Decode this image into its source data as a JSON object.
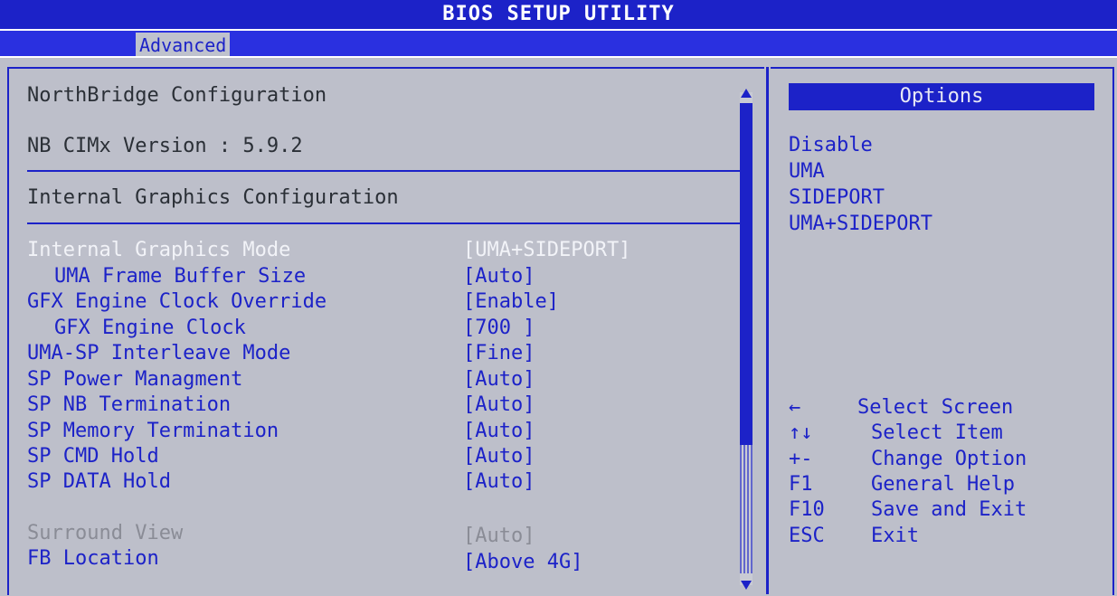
{
  "title": "BIOS SETUP UTILITY",
  "active_tab": "Advanced",
  "section_title": "NorthBridge Configuration",
  "version_line": "NB CIMx Version : 5.9.2",
  "subsection_title": "Internal Graphics Configuration",
  "settings": [
    {
      "label": "Internal Graphics Mode",
      "value": "[UMA+SIDEPORT]"
    },
    {
      "label": "UMA Frame Buffer Size",
      "value": "[Auto]"
    },
    {
      "label": "GFX Engine Clock Override",
      "value": "[Enable]"
    },
    {
      "label": "GFX Engine Clock",
      "value": "[700 ]"
    },
    {
      "label": "UMA-SP Interleave Mode",
      "value": "[Fine]"
    },
    {
      "label": "SP Power Managment",
      "value": "[Auto]"
    },
    {
      "label": "SP NB Termination",
      "value": "[Auto]"
    },
    {
      "label": "SP Memory Termination",
      "value": "[Auto]"
    },
    {
      "label": "SP CMD Hold",
      "value": "[Auto]"
    },
    {
      "label": "SP DATA Hold",
      "value": "[Auto]"
    },
    {
      "label": "Surround View",
      "value": "[Auto]"
    },
    {
      "label": "FB Location",
      "value": "[Above 4G]"
    }
  ],
  "options_header": "Options",
  "options": [
    "Disable",
    "UMA",
    "SIDEPORT",
    "UMA+SIDEPORT"
  ],
  "help_keys": [
    {
      "key": "←",
      "action": "Select Screen"
    },
    {
      "key": "↑↓",
      "action": "Select Item"
    },
    {
      "key": "+-",
      "action": "Change Option"
    },
    {
      "key": "F1",
      "action": "General Help"
    },
    {
      "key": "F10",
      "action": "Save and Exit"
    },
    {
      "key": "ESC",
      "action": "Exit"
    }
  ],
  "colors": {
    "bios_blue": "#1c22c8",
    "panel_gray": "#bdbfca",
    "highlight": "#f2f3f8"
  }
}
